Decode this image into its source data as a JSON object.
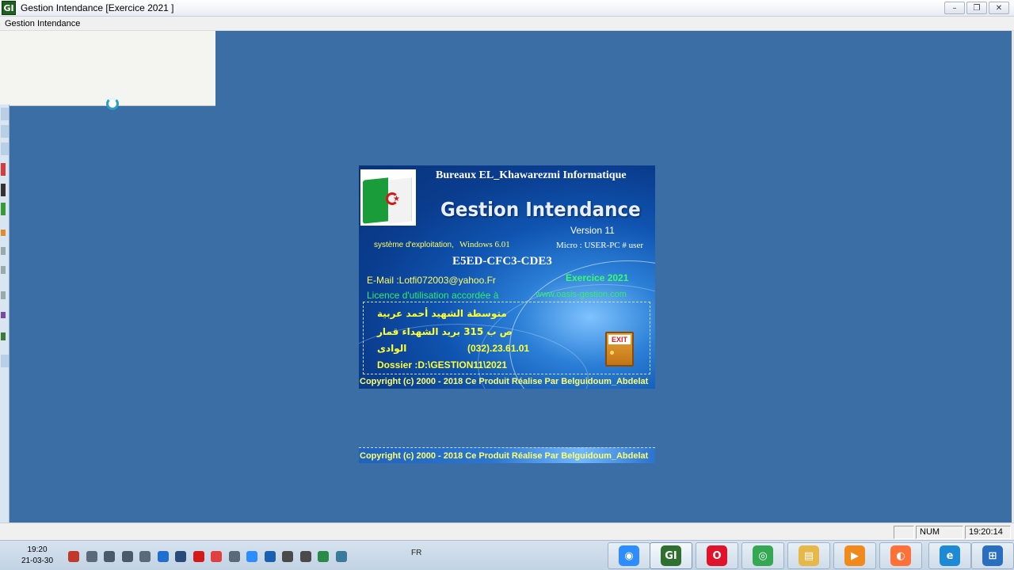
{
  "window": {
    "app_icon": "GI",
    "title": "Gestion Intendance [Exercice  2021 ]",
    "controls": [
      "minimize-icon",
      "restore-icon",
      "close-icon"
    ],
    "control_glyphs": [
      "–",
      "❐",
      "✕"
    ]
  },
  "menu": {
    "items": [
      "Gestion Intendance"
    ]
  },
  "splash": {
    "company": "Bureaux EL_Khawarezmi Informatique",
    "product": "Gestion Intendance",
    "version": "Version 11",
    "os_label": "système d'exploitation,",
    "os_value": "Windows 6.01",
    "micro": "Micro : USER-PC # user",
    "serial": "E5ED-CFC3-CDE3",
    "email": "E-Mail :Lotfi072003@yahoo.Fr",
    "exercice": "Exercice 2021",
    "licence": "Licence d'utilisation accordée à",
    "website": "www.oasis-gestion.com",
    "school": "متوسطة الشهيد أحمد عربية",
    "address": "ص ب 315 بريد الشهداء قمار",
    "city": "الوادى",
    "phone": "(032).23.61.01",
    "dossier": "Dossier :D:\\GESTION11\\2021",
    "copyright": "Copyright (c) 2000 - 2018 Ce Produit Réalise Par Belguidoum_Abdelat",
    "exit_label": "EXIT"
  },
  "copy_strip": {
    "text": "Copyright (c) 2000 - 2018 Ce Produit Réalise Par Belguidoum_Abdelat"
  },
  "statusbar": {
    "num": "NUM",
    "time": "19:20:14"
  },
  "taskbar": {
    "time": "19:20",
    "date": "21-03-30",
    "language": "FR",
    "tray_icons": [
      "tool-icon",
      "network-icon",
      "volume-icon",
      "signal-icon",
      "printer-icon",
      "teamviewer-icon",
      "monitor-icon",
      "opera-tray-icon",
      "anydesk-icon",
      "usb-icon",
      "zoom-tray-icon",
      "bluetooth-icon",
      "scissors-icon",
      "printer2-icon",
      "security-icon",
      "ccleaner-icon"
    ],
    "pinned": [
      {
        "name": "zoom",
        "glyph": "◉",
        "color": "#2d8cff"
      },
      {
        "name": "gestion-intendance",
        "glyph": "GI",
        "color": "#2f6f2f"
      },
      {
        "name": "opera",
        "glyph": "O",
        "color": "#e0132b"
      },
      {
        "name": "chrome",
        "glyph": "◎",
        "color": "#34a853"
      },
      {
        "name": "file-explorer",
        "glyph": "▤",
        "color": "#e6b84a"
      },
      {
        "name": "media-player",
        "glyph": "▶",
        "color": "#f08a1c"
      },
      {
        "name": "firefox",
        "glyph": "◐",
        "color": "#ff7139"
      },
      {
        "name": "internet-explorer",
        "glyph": "e",
        "color": "#1e8ad6"
      },
      {
        "name": "start",
        "glyph": "⊞",
        "color": "#2a6ec0"
      }
    ]
  }
}
